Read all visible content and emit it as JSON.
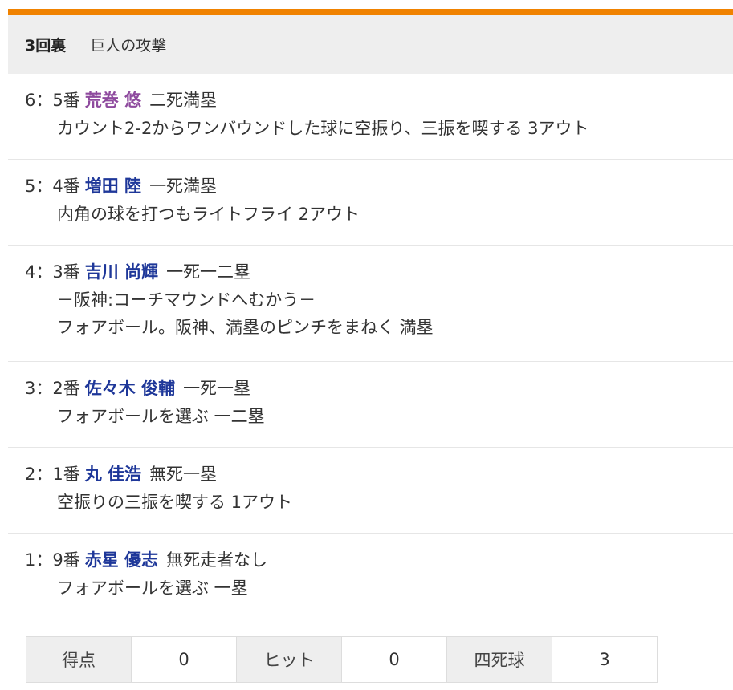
{
  "colors": {
    "top_bar": "#f08200",
    "header_bg": "#eeeeee",
    "batter_link": "#1e3799",
    "batter_visited": "#8e4a9e",
    "text": "#333333"
  },
  "inning": {
    "number": "3回裏",
    "team_attack": "巨人の攻撃"
  },
  "plays": [
    {
      "num": "6",
      "sep": "：",
      "order": "5番",
      "batter": "荒巻 悠",
      "batter_color": "#8e4a9e",
      "situation": "二死満塁",
      "description": [
        "カウント2-2からワンバウンドした球に空振り、三振を喫する 3アウト"
      ]
    },
    {
      "num": "5",
      "sep": "：",
      "order": "4番",
      "batter": "増田 陸",
      "batter_color": "#1e3799",
      "situation": "一死満塁",
      "description": [
        "内角の球を打つもライトフライ 2アウト"
      ]
    },
    {
      "num": "4",
      "sep": "：",
      "order": "3番",
      "batter": "吉川 尚輝",
      "batter_color": "#1e3799",
      "situation": "一死一二塁",
      "description": [
        "－阪神:コーチマウンドへむかう－",
        "フォアボール。阪神、満塁のピンチをまねく 満塁"
      ]
    },
    {
      "num": "3",
      "sep": "：",
      "order": "2番",
      "batter": "佐々木 俊輔",
      "batter_color": "#1e3799",
      "situation": "一死一塁",
      "description": [
        "フォアボールを選ぶ 一二塁"
      ]
    },
    {
      "num": "2",
      "sep": "：",
      "order": "1番",
      "batter": "丸 佳浩",
      "batter_color": "#1e3799",
      "situation": "無死一塁",
      "description": [
        "空振りの三振を喫する 1アウト"
      ]
    },
    {
      "num": "1",
      "sep": "：",
      "order": "9番",
      "batter": "赤星 優志",
      "batter_color": "#1e3799",
      "situation": "無死走者なし",
      "description": [
        "フォアボールを選ぶ 一塁"
      ]
    }
  ],
  "summary": [
    {
      "label": "得点",
      "value": "0"
    },
    {
      "label": "ヒット",
      "value": "0"
    },
    {
      "label": "四死球",
      "value": "3"
    }
  ]
}
